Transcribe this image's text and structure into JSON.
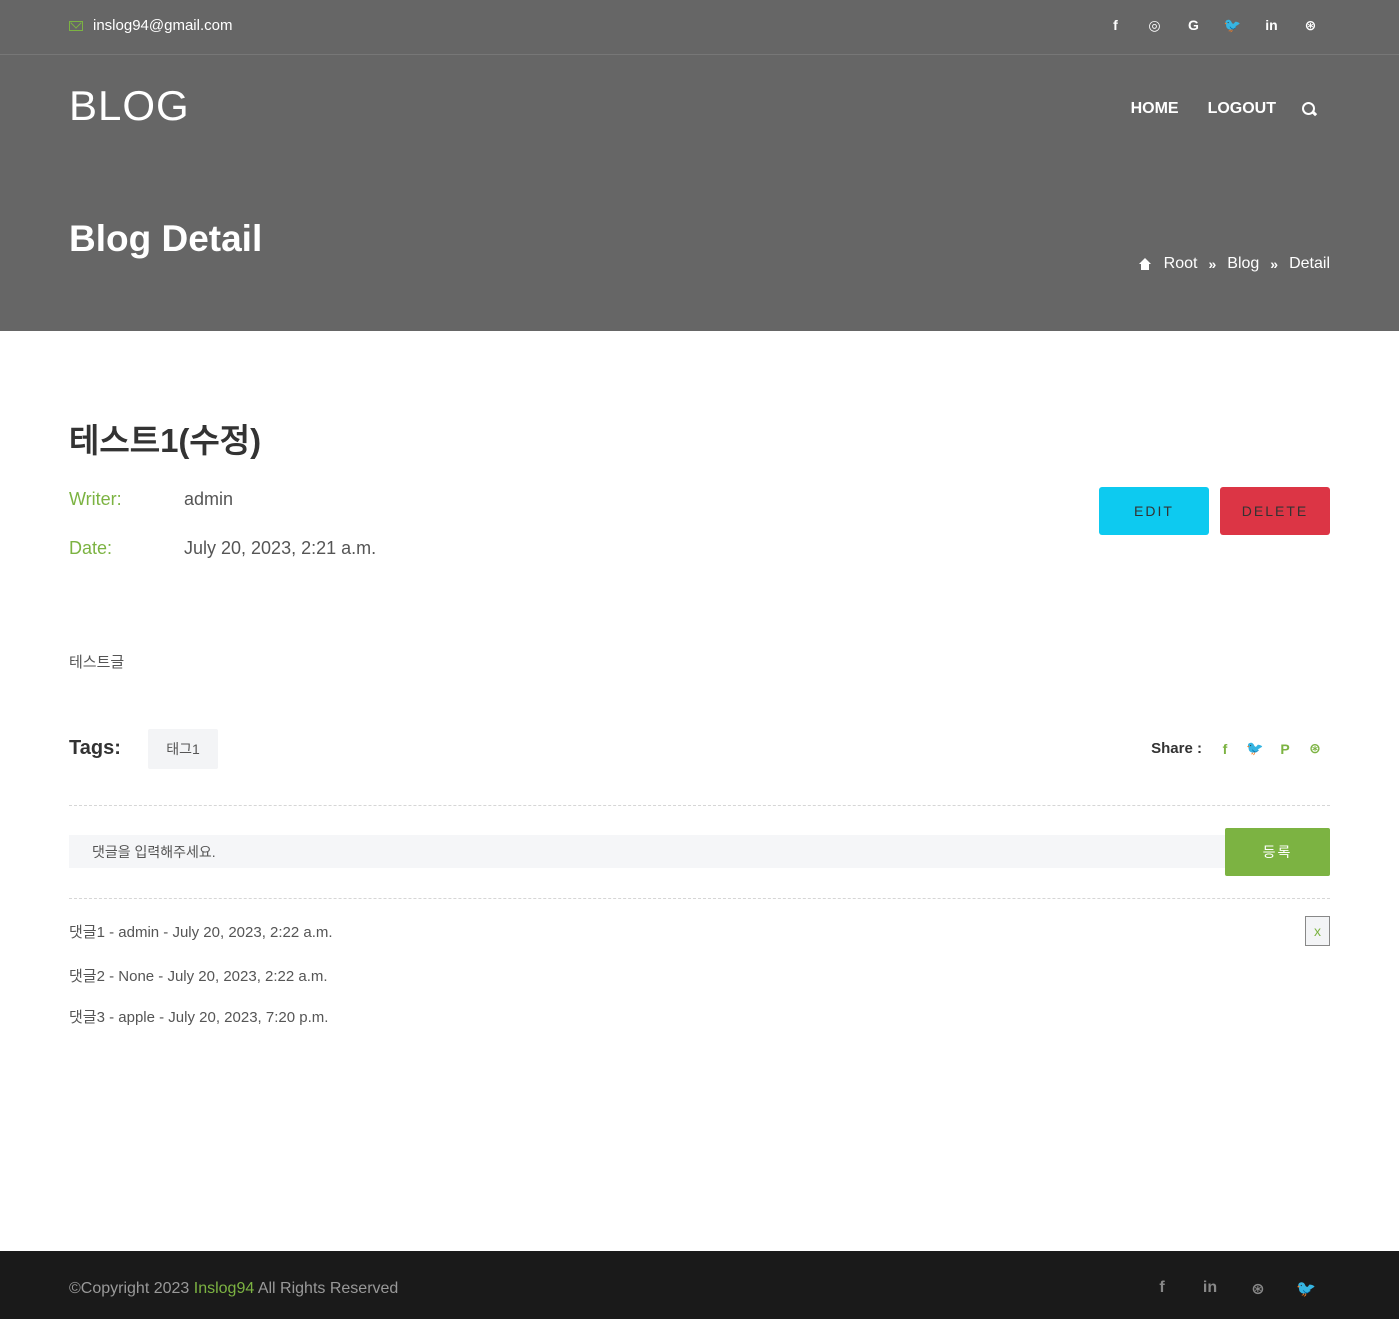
{
  "topbar": {
    "email": "inslog94@gmail.com",
    "socials": [
      {
        "name": "facebook-icon",
        "glyph": "f"
      },
      {
        "name": "instagram-icon",
        "glyph": "◎"
      },
      {
        "name": "google-icon",
        "glyph": "G"
      },
      {
        "name": "twitter-icon",
        "glyph": "🐦"
      },
      {
        "name": "linkedin-icon",
        "glyph": "in"
      },
      {
        "name": "dribbble-icon",
        "glyph": "⊛"
      }
    ]
  },
  "header": {
    "brand": "BLOG",
    "nav": {
      "home": "HOME",
      "logout": "LOGOUT"
    },
    "page_heading": "Blog Detail",
    "breadcrumb": {
      "root": "Root",
      "sep": "»",
      "blog": "Blog",
      "detail": "Detail"
    }
  },
  "post": {
    "title": "테스트1(수정)",
    "writer_label": "Writer:",
    "writer": "admin",
    "date_label": "Date:",
    "date": "July 20, 2023, 2:21 a.m.",
    "edit_label": "EDIT",
    "delete_label": "DELETE",
    "content": "테스트글",
    "tags_label": "Tags:",
    "tags": [
      "태그1"
    ],
    "share_label": "Share :",
    "share_icons": [
      "f",
      "🐦",
      "P",
      "⊛"
    ]
  },
  "comment_form": {
    "placeholder": "댓글을 입력해주세요.",
    "submit_label": "등록"
  },
  "comments": [
    {
      "text": "댓글1 - admin - July 20, 2023, 2:22 a.m.",
      "delete_label": "x"
    },
    {
      "text": "댓글2 - None - July 20, 2023, 2:22 a.m."
    },
    {
      "text": "댓글3 - apple - July 20, 2023, 7:20 p.m."
    }
  ],
  "footer": {
    "copy_prefix": "©Copyright 2023 ",
    "copy_accent": "Inslog94",
    "copy_suffix": " All Rights Reserved",
    "socials": [
      "f",
      "in",
      "⊛",
      "🐦"
    ]
  },
  "colors": {
    "header_bg": "#666666",
    "accent": "#7cb342",
    "edit": "#0dcaf0",
    "delete": "#dc3545",
    "footer_bg": "#1a1a1a"
  }
}
